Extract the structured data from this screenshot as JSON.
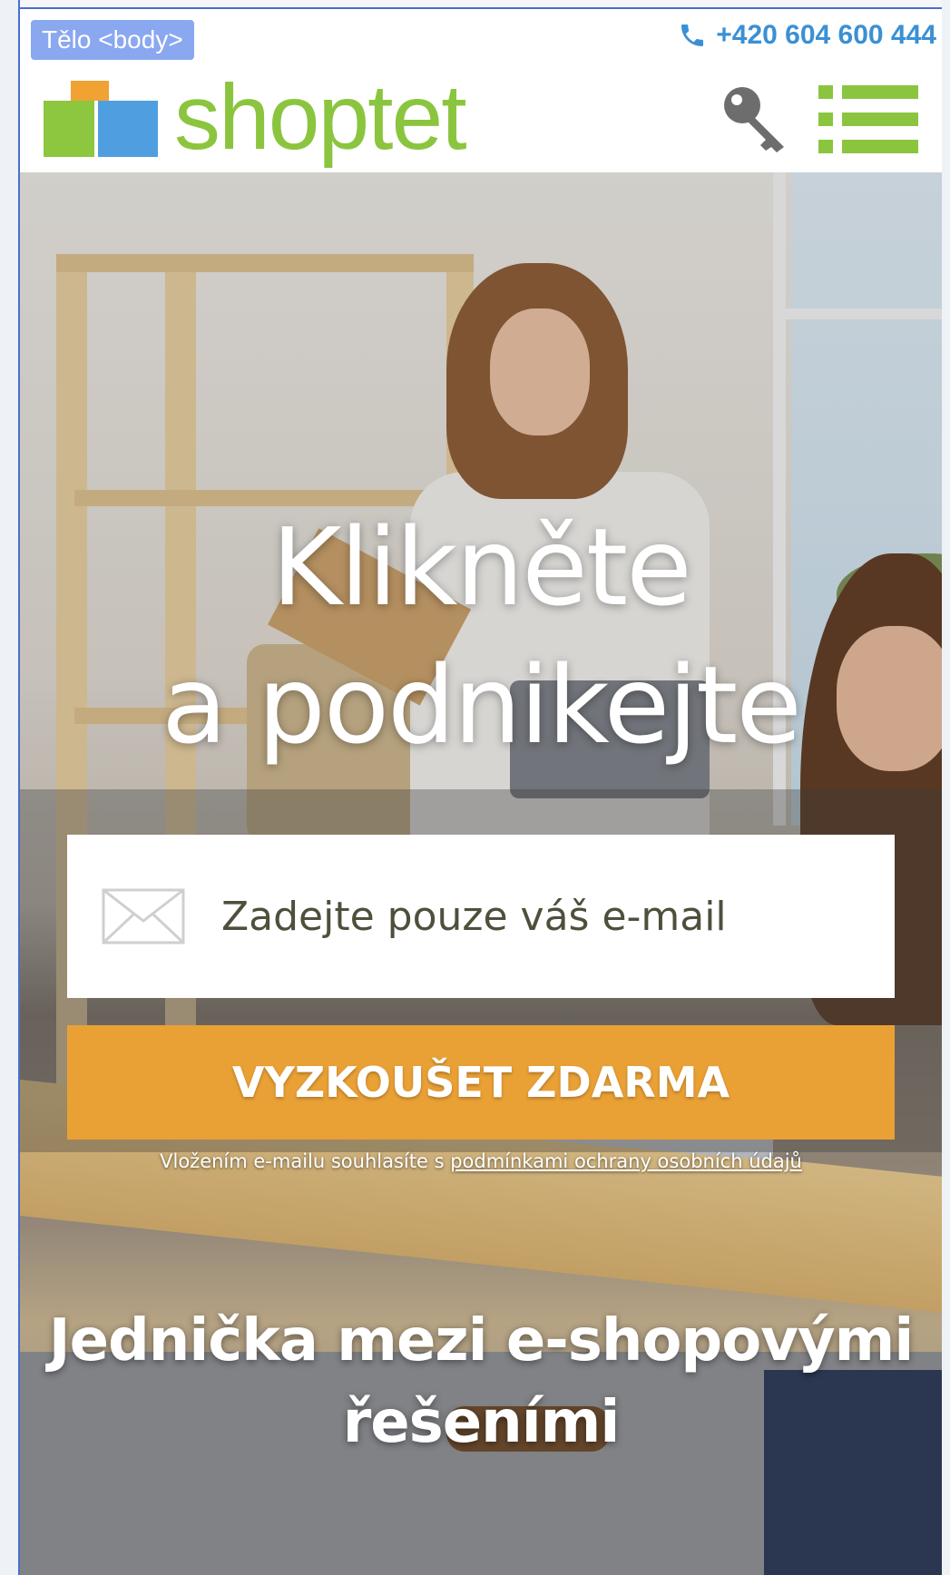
{
  "inspector": {
    "tag_label": "Tělo <body>"
  },
  "header": {
    "phone": "+420 604 600 444",
    "logo_text": "shoptet",
    "colors": {
      "green": "#8bc53f",
      "blue": "#4f9fe0",
      "orange": "#f0a233",
      "phone_blue": "#3a90d4"
    },
    "icons": [
      "phone-icon",
      "key-icon",
      "menu-icon"
    ]
  },
  "hero": {
    "headline_line1": "Klikněte",
    "headline_line2": "a podnikejte",
    "email_placeholder": "Zadejte pouze váš e-mail",
    "cta_label": "VYZKOUŠET ZDARMA",
    "cta_color": "#e9a035",
    "consent_prefix": "Vložením e-mailu souhlasíte s ",
    "consent_link": "podmínkami ochrany osobních údajů",
    "subhead_line1": "Jednička mezi e-shopovými",
    "subhead_line2": "řešeními"
  }
}
